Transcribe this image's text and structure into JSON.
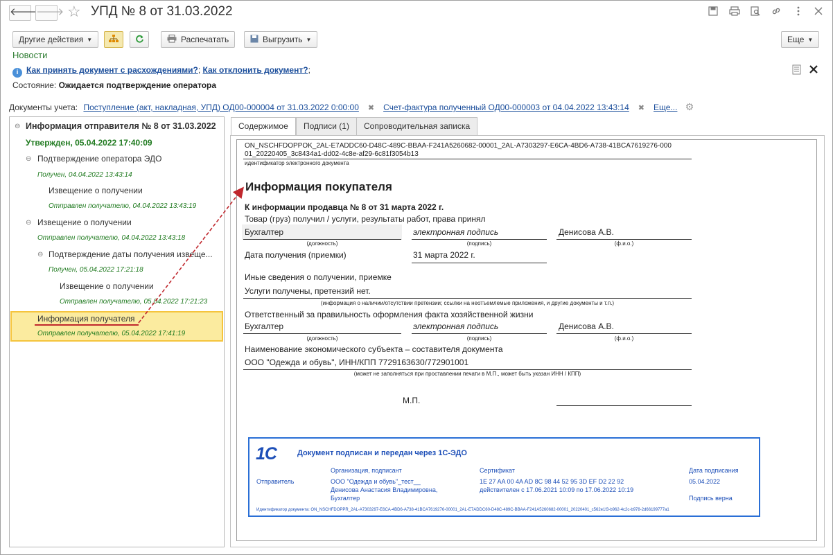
{
  "window": {
    "title": "УПД № 8 от 31.03.2022",
    "back_glyph": "🡐",
    "forward_glyph": "🡒",
    "star_glyph": "☆"
  },
  "toolbar": {
    "other_actions": "Другие действия",
    "print": "Распечатать",
    "export": "Выгрузить",
    "more": "Еще"
  },
  "news": {
    "label": "Новости"
  },
  "info": {
    "link_accept": "Как принять документ с расхождениями?",
    "sep": ";",
    "link_reject": "Как отклонить документ?",
    "end": ";"
  },
  "state": {
    "label": "Состояние:",
    "value": "Ожидается подтверждение оператора"
  },
  "docs": {
    "label": "Документы учета:",
    "doc1": "Поступление (акт, накладная, УПД) ОД00-000004 от 31.03.2022 0:00:00",
    "doc2": "Счет-фактура полученный ОД00-000003 от 04.04.2022 13:43:14",
    "more": "Еще..."
  },
  "tree": {
    "root": "Информация отправителя № 8 от 31.03.2022",
    "root_status": "Утвержден, 05.04.2022 17:40:09",
    "n1": "Подтверждение оператора ЭДО",
    "n1_status": "Получен, 04.04.2022 13:43:14",
    "n1a": "Извещение о получении",
    "n1a_status": "Отправлен получателю, 04.04.2022 13:43:19",
    "n2": "Извещение о получении",
    "n2_status": "Отправлен получателю, 04.04.2022 13:43:18",
    "n2a": "Подтверждение даты получения извеще...",
    "n2a_status": "Получен, 05.04.2022 17:21:18",
    "n2b": "Извещение о получении",
    "n2b_status": "Отправлен получателю, 05.04.2022 17:21:23",
    "n3": "Информация получателя",
    "n3_status": "Отправлен получателю, 05.04.2022 17:41:19"
  },
  "tabs": {
    "content": "Содержимое",
    "signatures": "Подписи (1)",
    "note": "Сопроводительная записка"
  },
  "document": {
    "id_line1": "ON_NSCHFDOPPOK_2AL-E7ADDC60-D48C-489C-BBAA-F241A5260682-00001_2AL-A7303297-E6CA-4BD6-A738-41BCA7619276-000",
    "id_line2": "01_20220405_3c8434a1-dd02-4c8e-af29-6c81f3054b13",
    "id_caption": "идентификатор электронного документа",
    "title": "Информация покупателя",
    "subtitle": "К информации продавца № 8 от 31 марта 2022 г.",
    "goods_received": "Товар (груз) получил / услуги, результаты работ, права принял",
    "position1": "Бухгалтер",
    "signature1": "электронная подпись",
    "name1": "Денисова А.В.",
    "cap_position": "(должность)",
    "cap_signature": "(подпись)",
    "cap_name": "(ф.и.о.)",
    "date_label": "Дата получения (приемки)",
    "date_value": "31 марта 2022 г.",
    "other_info": "Иные сведения о получении, приемке",
    "other_value": "Услуги получены, претензий нет.",
    "other_caption": "(информация о наличии/отсутствии претензии; ссылки на неотъемлемые приложения, и другие  документы и т.п.)",
    "responsible": "Ответственный за правильность оформления факта хозяйственной жизни",
    "position2": "Бухгалтер",
    "signature2": "электронная подпись",
    "name2": "Денисова А.В.",
    "entity_label": "Наименование экономического субъекта – составителя документа",
    "entity_value": "ООО \"Одежда и обувь\", ИНН/КПП 7729163630/772901001",
    "entity_caption": "(может не заполняться при проставлении печати в М.П., может быть указан ИНН / КПП)",
    "mp": "М.П."
  },
  "stamp": {
    "logo": "1С",
    "title": "Документ подписан и передан через 1С-ЭДО",
    "col_org": "Организация, подписант",
    "col_cert": "Сертификат",
    "col_date": "Дата подписания",
    "role": "Отправитель",
    "org1": "ООО \"Одежда и обувь\"_тест__",
    "org2": "Денисова Анастасия Владимировна,",
    "org3": "Бухгалтер",
    "cert1": "1E 27 AA 00 4A AD 8C 98 44 52 95 3D EF D2 22 92",
    "cert2": "действителен с 17.06.2021 10:09 по 17.06.2022 10:19",
    "date": "05.04.2022",
    "valid": "Подпись верна",
    "doc_id": "Идентификатор документа: ON_NSCHFDOPPR_2AL-A7303297-E6CA-4BD6-A738-41BCA7619276-00001_2AL-E7ADDC60-D48C-489C-BBAA-F241A5260682-00001_20220401_c562e1f3-b962-4c2c-b978-2d66199777a1"
  },
  "colors": {
    "link": "#1b4e9b",
    "green": "#2e7d32",
    "selected": "#fbeb9f",
    "stamp_blue": "#1d4fb8",
    "arrow": "#c0272d"
  }
}
